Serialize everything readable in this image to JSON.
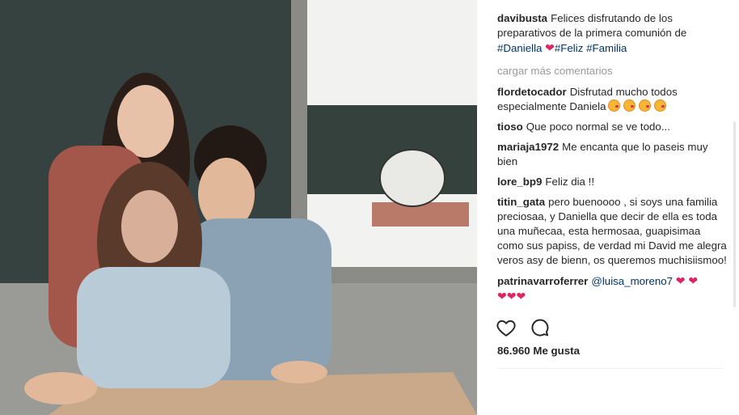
{
  "caption": {
    "user": "davibusta",
    "text": "Felices disfrutando de los preparativos de la primera comunión de",
    "tag1": "#Daniella",
    "heart": "❤",
    "tag2": "#Feliz",
    "tag3": "#Familia"
  },
  "load_more": "cargar más comentarios",
  "comments": [
    {
      "user": "flordetocador",
      "text": "Disfrutad mucho todos especialmente Daniela"
    },
    {
      "user": "tioso",
      "text": "Que poco normal se ve todo..."
    },
    {
      "user": "mariaja1972",
      "text": "Me encanta que lo paseis muy bien"
    },
    {
      "user": "lore_bp9",
      "text": "Feliz dia !!"
    },
    {
      "user": "titin_gata",
      "text": "pero buenoooo , si soys una familia preciosaa, y Daniella que decir de ella es toda una muñecaa, esta hermosaa, guapisimaa como sus papiss, de verdad mi David me alegra veros asy de bienn, os queremos muchisiismoo!"
    },
    {
      "user": "patrinavarroferrer",
      "mention": "@luisa_moreno7",
      "hearts1": "❤ ❤",
      "hearts2": "❤❤❤"
    }
  ],
  "likes": "86.960 Me gusta",
  "icons": {
    "like": "heart-outline-icon",
    "comment": "speech-bubble-icon"
  }
}
